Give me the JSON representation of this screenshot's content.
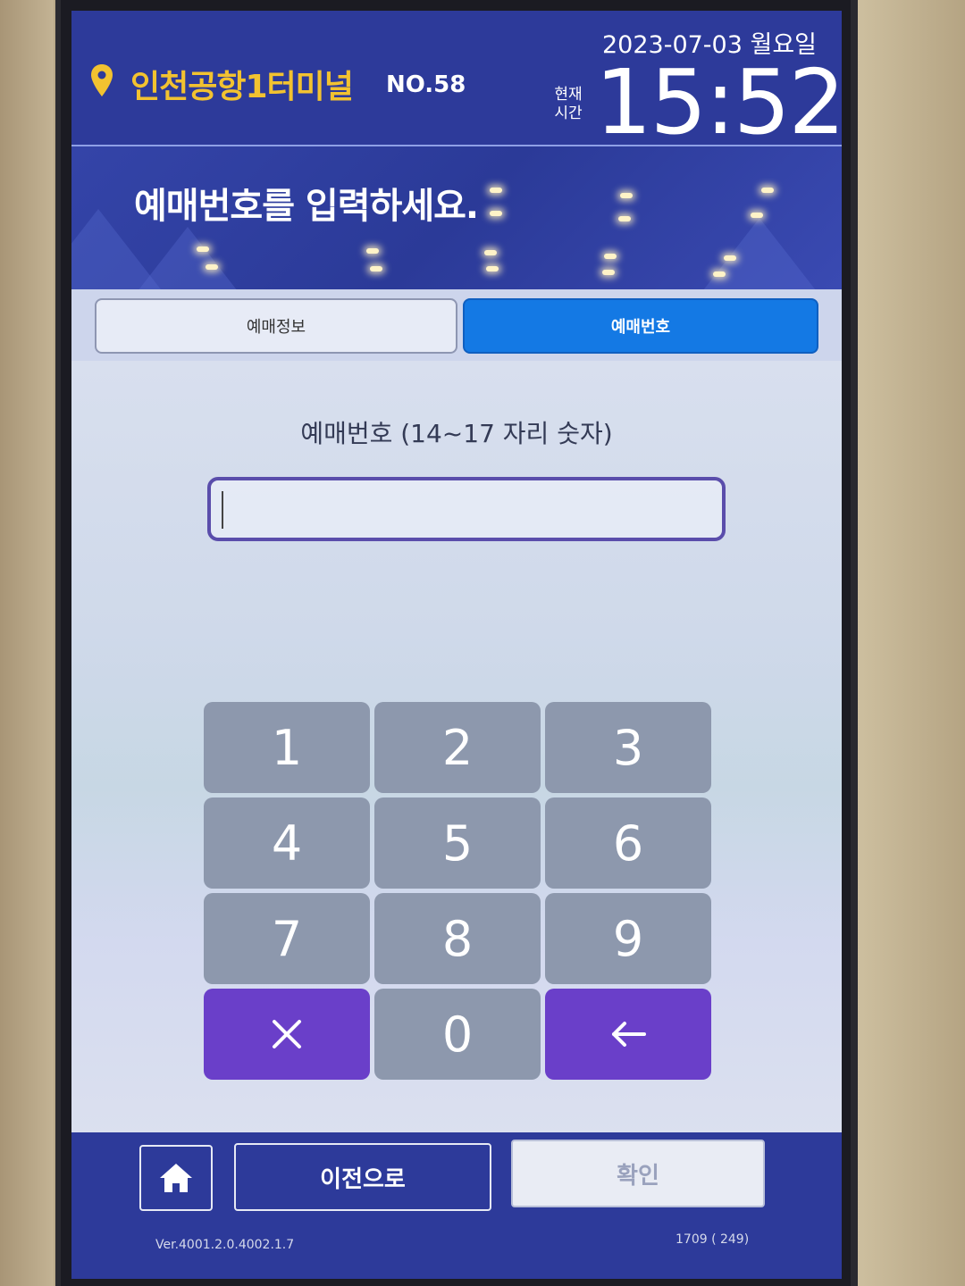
{
  "header": {
    "location_icon": "map-pin-icon",
    "station_name": "인천공항1터미널",
    "station_no": "NO.58",
    "date": "2023-07-03 월요일",
    "time_label": "현재\n시간",
    "time_label_line1": "현재",
    "time_label_line2": "시간",
    "time": "15:52"
  },
  "banner": {
    "title": "예매번호를 입력하세요."
  },
  "tabs": [
    {
      "label": "예매정보",
      "active": false
    },
    {
      "label": "예매번호",
      "active": true
    }
  ],
  "form": {
    "label": "예매번호 (14~17 자리 숫자)",
    "value": ""
  },
  "keypad": {
    "keys": [
      "1",
      "2",
      "3",
      "4",
      "5",
      "6",
      "7",
      "8",
      "9",
      "clear-icon",
      "0",
      "backspace-icon"
    ]
  },
  "footer": {
    "home_icon": "home-icon",
    "prev_label": "이전으로",
    "confirm_label": "확인",
    "version": "Ver.4001.2.0.4002.1.7",
    "counter": "1709 ( 249)"
  },
  "colors": {
    "header_bg": "#2d3a9a",
    "station_name": "#f2c230",
    "active_tab": "#1479e4",
    "input_border": "#5a4dab",
    "key_gray": "#8d98ad",
    "key_purple": "#6a3fc9"
  }
}
